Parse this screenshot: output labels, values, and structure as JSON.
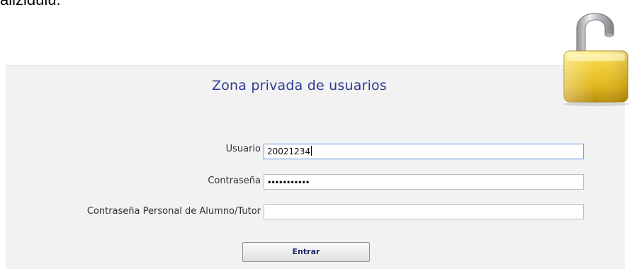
{
  "top_text_fragment": "alizidulu.",
  "form": {
    "title": "Zona privada de usuarios",
    "fields": [
      {
        "label": "Usuario",
        "value": "20021234"
      },
      {
        "label": "Contraseña",
        "value": "•••••••••••"
      },
      {
        "label": "Contraseña Personal de Alumno/Tutor",
        "value": ""
      }
    ],
    "submit_label": "Entrar"
  },
  "icons": {
    "lock": "unlocked-padlock-icon"
  },
  "colors": {
    "panel_background": "#f2f2f2",
    "title_color": "#2f3b91",
    "lock_gold": "#e0b51a"
  }
}
